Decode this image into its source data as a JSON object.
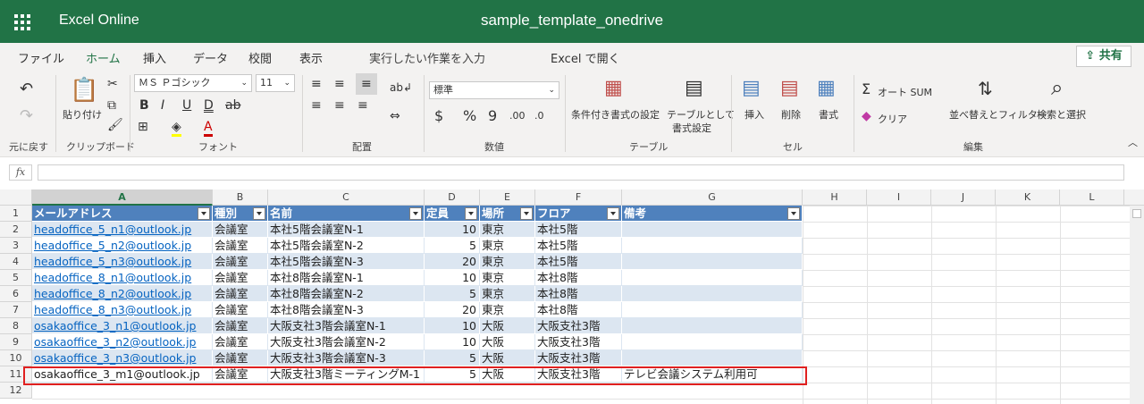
{
  "app": {
    "name": "Excel Online",
    "doc_title": "sample_template_onedrive"
  },
  "tabs": [
    "ファイル",
    "ホーム",
    "挿入",
    "データ",
    "校閲",
    "表示",
    "実行したい作業を入力",
    "Excel で開く"
  ],
  "share_label": "共有",
  "ribbon": {
    "undo_group_label": "元に戻す",
    "paste_label": "貼り付け",
    "clipboard_label": "クリップボード",
    "font_name": "ＭＳ Ｐゴシック",
    "font_size": "11",
    "font_label": "フォント",
    "align_label": "配置",
    "number_format": "標準",
    "number_label": "数値",
    "cond_format_label": "条件付き書式の設定",
    "table_format_label1": "テーブルとして",
    "table_format_label2": "書式設定",
    "table_label": "テーブル",
    "insert_label": "挿入",
    "delete_label": "削除",
    "format_label": "書式",
    "cells_label": "セル",
    "autosum_label": "オート SUM",
    "clear_label": "クリア",
    "sort_label": "並べ替えとフィルター",
    "find_label": "検索と選択",
    "edit_label": "編集"
  },
  "formula_bar": {
    "fx": "fx",
    "value": ""
  },
  "columns": [
    "A",
    "B",
    "C",
    "D",
    "E",
    "F",
    "G",
    "H",
    "I",
    "J",
    "K",
    "L"
  ],
  "row_numbers": [
    "1",
    "2",
    "3",
    "4",
    "5",
    "6",
    "7",
    "8",
    "9",
    "10",
    "11",
    "12"
  ],
  "table": {
    "headers": [
      "メールアドレス",
      "種別",
      "名前",
      "定員",
      "場所",
      "フロア",
      "備考"
    ],
    "rows": [
      [
        "headoffice_5_n1@outlook.jp",
        "会議室",
        "本社5階会議室N-1",
        "10",
        "東京",
        "本社5階",
        ""
      ],
      [
        "headoffice_5_n2@outlook.jp",
        "会議室",
        "本社5階会議室N-2",
        "5",
        "東京",
        "本社5階",
        ""
      ],
      [
        "headoffice_5_n3@outlook.jp",
        "会議室",
        "本社5階会議室N-3",
        "20",
        "東京",
        "本社5階",
        ""
      ],
      [
        "headoffice_8_n1@outlook.jp",
        "会議室",
        "本社8階会議室N-1",
        "10",
        "東京",
        "本社8階",
        ""
      ],
      [
        "headoffice_8_n2@outlook.jp",
        "会議室",
        "本社8階会議室N-2",
        "5",
        "東京",
        "本社8階",
        ""
      ],
      [
        "headoffice_8_n3@outlook.jp",
        "会議室",
        "本社8階会議室N-3",
        "20",
        "東京",
        "本社8階",
        ""
      ],
      [
        "osakaoffice_3_n1@outlook.jp",
        "会議室",
        "大阪支社3階会議室N-1",
        "10",
        "大阪",
        "大阪支社3階",
        ""
      ],
      [
        "osakaoffice_3_n2@outlook.jp",
        "会議室",
        "大阪支社3階会議室N-2",
        "10",
        "大阪",
        "大阪支社3階",
        ""
      ],
      [
        "osakaoffice_3_n3@outlook.jp",
        "会議室",
        "大阪支社3階会議室N-3",
        "5",
        "大阪",
        "大阪支社3階",
        ""
      ],
      [
        "osakaoffice_3_m1@outlook.jp",
        "会議室",
        "大阪支社3階ミーティングM-1",
        "5",
        "大阪",
        "大阪支社3階",
        "テレビ会議システム利用可"
      ]
    ]
  }
}
